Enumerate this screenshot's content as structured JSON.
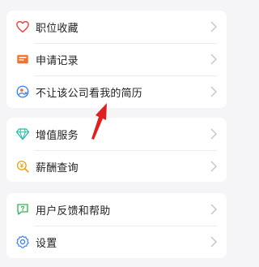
{
  "groups": [
    {
      "items": [
        {
          "label": "职位收藏",
          "icon": "heart-icon",
          "color": "#e84a4a"
        },
        {
          "label": "申请记录",
          "icon": "envelope-icon",
          "color": "#f0732f"
        },
        {
          "label": "不让该公司看我的简历",
          "icon": "hide-resume-icon",
          "color": "#3b82f6"
        }
      ]
    },
    {
      "items": [
        {
          "label": "增值服务",
          "icon": "diamond-icon",
          "color": "#2bb9a5"
        },
        {
          "label": "薪酬查询",
          "icon": "salary-search-icon",
          "color": "#e9a321"
        }
      ]
    },
    {
      "items": [
        {
          "label": "用户反馈和帮助",
          "icon": "feedback-help-icon",
          "color": "#34b35a"
        },
        {
          "label": "设置",
          "icon": "gear-icon",
          "color": "#3b82f6"
        }
      ]
    }
  ],
  "annotation": {
    "icon": "red-arrow",
    "color": "#e02020"
  }
}
